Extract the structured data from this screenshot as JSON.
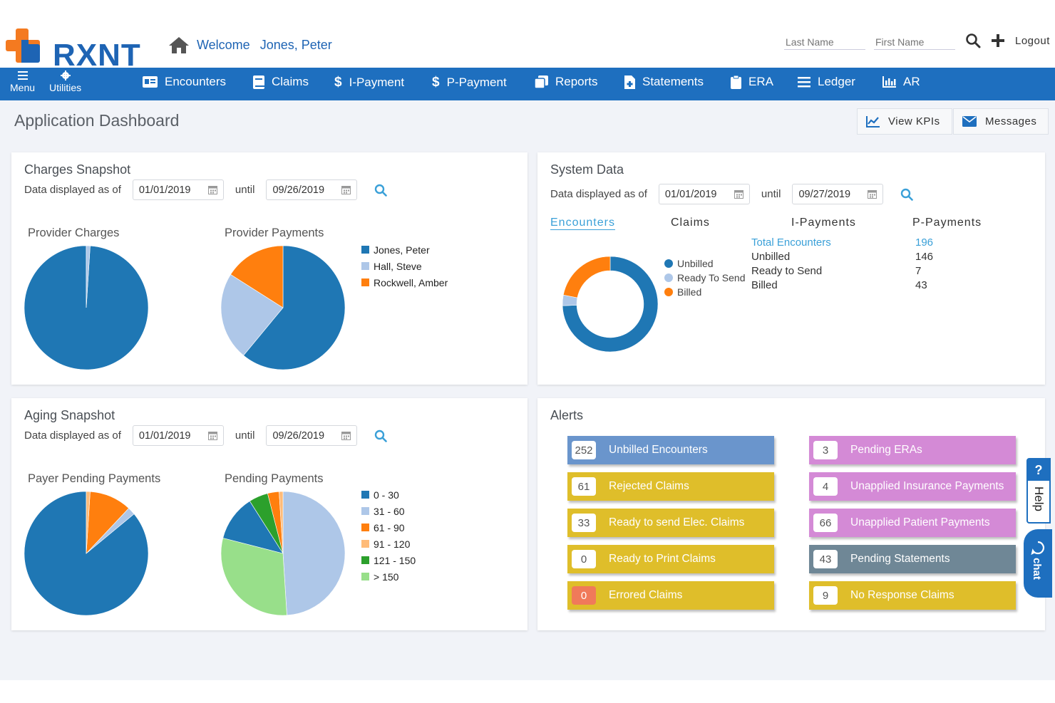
{
  "header": {
    "logo_text": "RXNT",
    "welcome": "Welcome",
    "user_name": "Jones, Peter",
    "last_name_placeholder": "Last Name",
    "first_name_placeholder": "First Name",
    "logout": "Logout"
  },
  "nav": {
    "menu": "Menu",
    "utilities": "Utilities",
    "items": [
      "Encounters",
      "Claims",
      "I-Payment",
      "P-Payment",
      "Reports",
      "Statements",
      "ERA",
      "Ledger",
      "AR"
    ]
  },
  "page": {
    "title": "Application Dashboard",
    "view_kpis": "View KPIs",
    "messages": "Messages"
  },
  "charges": {
    "title": "Charges Snapshot",
    "data_label": "Data displayed as of",
    "from": "01/01/2019",
    "until": "until",
    "to": "09/26/2019",
    "provider_charges": "Provider Charges",
    "provider_payments": "Provider Payments"
  },
  "system": {
    "title": "System Data",
    "data_label": "Data displayed as of",
    "from": "01/01/2019",
    "until": "until",
    "to": "09/27/2019",
    "tabs": [
      "Encounters",
      "Claims",
      "I-Payments",
      "P-Payments"
    ],
    "legend": [
      "Unbilled",
      "Ready To Send",
      "Billed"
    ],
    "stats": [
      {
        "label": "Total Encounters",
        "value": "196"
      },
      {
        "label": "Unbilled",
        "value": "146"
      },
      {
        "label": "Ready to Send",
        "value": "7"
      },
      {
        "label": "Billed",
        "value": "43"
      }
    ]
  },
  "aging": {
    "title": "Aging Snapshot",
    "data_label": "Data displayed as of",
    "from": "01/01/2019",
    "until": "until",
    "to": "09/26/2019",
    "payer_pending": "Payer Pending Payments",
    "pending": "Pending Payments"
  },
  "alerts": {
    "title": "Alerts",
    "left": [
      {
        "count": "252",
        "label": "Unbilled Encounters"
      },
      {
        "count": "61",
        "label": "Rejected Claims"
      },
      {
        "count": "33",
        "label": "Ready to send Elec. Claims"
      },
      {
        "count": "0",
        "label": "Ready to Print Claims"
      },
      {
        "count": "0",
        "label": "Errored Claims"
      }
    ],
    "right": [
      {
        "count": "3",
        "label": "Pending ERAs"
      },
      {
        "count": "4",
        "label": "Unapplied Insurance Payments"
      },
      {
        "count": "66",
        "label": "Unapplied Patient Payments"
      },
      {
        "count": "43",
        "label": "Pending Statements"
      },
      {
        "count": "9",
        "label": "No Response Claims"
      }
    ]
  },
  "help": {
    "q": "?",
    "label": "Help",
    "chat": "chat"
  },
  "colors": {
    "nav": "#1e6fbf",
    "brand_orange": "#f47a20",
    "brand_blue": "#1e64b4",
    "series_blue": "#1f77b4",
    "series_light": "#aec7e8",
    "series_orange": "#ff7f0e"
  },
  "chart_data": [
    {
      "type": "pie",
      "title": "Provider Charges",
      "categories": [
        "Jones, Peter",
        "Hall, Steve",
        "Rockwell, Amber"
      ],
      "values": [
        99,
        1,
        0
      ]
    },
    {
      "type": "pie",
      "title": "Provider Payments",
      "categories": [
        "Jones, Peter",
        "Hall, Steve",
        "Rockwell, Amber"
      ],
      "values": [
        61,
        23,
        16
      ],
      "legend": "right"
    },
    {
      "type": "pie",
      "title": "Encounters",
      "categories": [
        "Unbilled",
        "Ready To Send",
        "Billed"
      ],
      "values": [
        146,
        7,
        43
      ],
      "donut": true
    },
    {
      "type": "pie",
      "title": "Payer Pending Payments",
      "categories": [
        "0 - 30",
        "31 - 60",
        "61 - 90",
        "91 - 120",
        "121 - 150",
        "> 150"
      ],
      "values": [
        86,
        2,
        11,
        1,
        0,
        0
      ]
    },
    {
      "type": "pie",
      "title": "Pending Payments",
      "categories": [
        "0 - 30",
        "31 - 60",
        "61 - 90",
        "91 - 120",
        "121 - 150",
        "> 150"
      ],
      "values": [
        12,
        49,
        3,
        1,
        5,
        30
      ],
      "legend": "right"
    }
  ]
}
